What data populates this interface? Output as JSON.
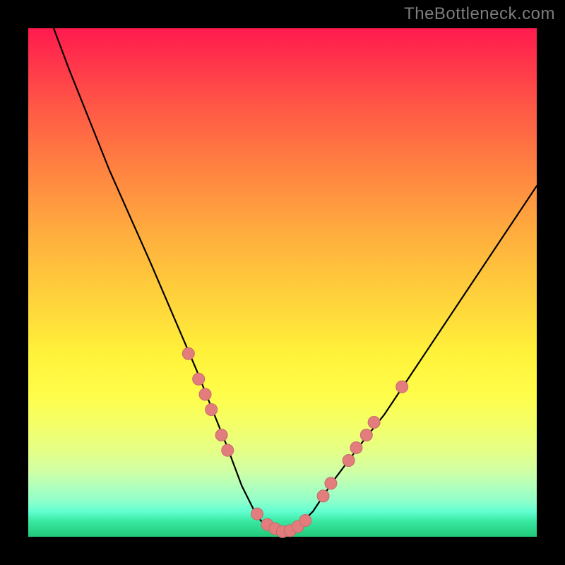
{
  "watermark": "TheBottleneck.com",
  "colors": {
    "curve_stroke": "#000000",
    "dot_fill": "#e37d7d",
    "dot_stroke": "#c46b6b",
    "gradient_top": "#ff1a4e",
    "gradient_bottom": "#22c97a",
    "page_bg": "#000000"
  },
  "chart_data": {
    "type": "line",
    "title": "",
    "xlabel": "",
    "ylabel": "",
    "xlim": [
      0,
      100
    ],
    "ylim": [
      0,
      100
    ],
    "series": [
      {
        "name": "left-branch",
        "x": [
          5,
          8,
          12,
          16,
          20,
          24,
          27,
          30,
          33,
          35,
          37,
          39,
          40.5,
          42,
          43.5,
          45,
          46.5,
          48,
          49,
          50
        ],
        "y": [
          100,
          92,
          82,
          72,
          63,
          54,
          47,
          40,
          33,
          28,
          23,
          18,
          14,
          10,
          7,
          4,
          2.4,
          1.6,
          1,
          0.5
        ]
      },
      {
        "name": "right-branch",
        "x": [
          50,
          51,
          52.5,
          54,
          56,
          58,
          60,
          63,
          66,
          70,
          74,
          78,
          82,
          86,
          90,
          94,
          98,
          100
        ],
        "y": [
          0.5,
          1,
          1.8,
          3,
          5,
          8,
          11,
          15,
          19,
          24,
          30,
          36,
          42,
          48,
          54,
          60,
          66,
          69
        ]
      }
    ],
    "dots": [
      {
        "x": 31.5,
        "y": 36
      },
      {
        "x": 33.5,
        "y": 31
      },
      {
        "x": 34.8,
        "y": 28
      },
      {
        "x": 36.0,
        "y": 25
      },
      {
        "x": 38.0,
        "y": 20
      },
      {
        "x": 39.2,
        "y": 17
      },
      {
        "x": 45.0,
        "y": 4.5
      },
      {
        "x": 47.0,
        "y": 2.4
      },
      {
        "x": 48.5,
        "y": 1.6
      },
      {
        "x": 50.0,
        "y": 1.0
      },
      {
        "x": 51.5,
        "y": 1.2
      },
      {
        "x": 53.0,
        "y": 2.0
      },
      {
        "x": 54.5,
        "y": 3.2
      },
      {
        "x": 58.0,
        "y": 8.0
      },
      {
        "x": 59.5,
        "y": 10.5
      },
      {
        "x": 63.0,
        "y": 15.0
      },
      {
        "x": 64.5,
        "y": 17.5
      },
      {
        "x": 66.5,
        "y": 20.0
      },
      {
        "x": 68.0,
        "y": 22.5
      },
      {
        "x": 73.5,
        "y": 29.5
      }
    ]
  }
}
